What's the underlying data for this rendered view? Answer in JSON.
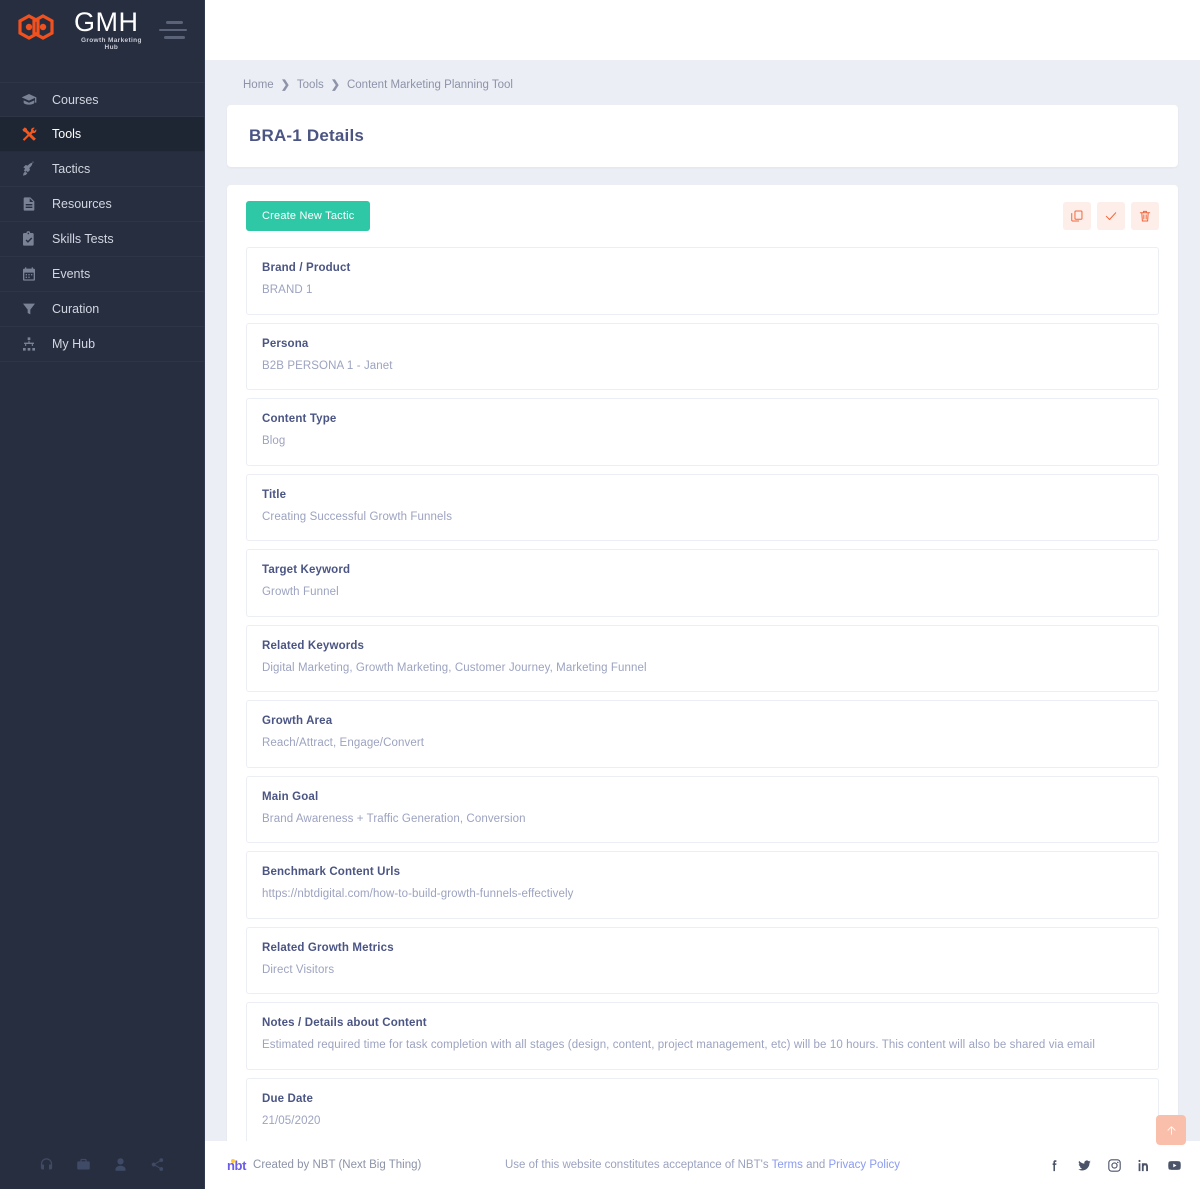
{
  "brand": {
    "logo_title": "GMH",
    "logo_subtitle": "Growth Marketing Hub",
    "accent_orange": "#f05a22"
  },
  "sidebar": {
    "items": [
      {
        "label": "Courses",
        "icon": "graduation-cap-icon",
        "active": false
      },
      {
        "label": "Tools",
        "icon": "tools-icon",
        "active": true
      },
      {
        "label": "Tactics",
        "icon": "rocket-icon",
        "active": false
      },
      {
        "label": "Resources",
        "icon": "document-icon",
        "active": false
      },
      {
        "label": "Skills Tests",
        "icon": "clipboard-check-icon",
        "active": false
      },
      {
        "label": "Events",
        "icon": "calendar-icon",
        "active": false
      },
      {
        "label": "Curation",
        "icon": "filter-icon",
        "active": false
      },
      {
        "label": "My Hub",
        "icon": "sitemap-icon",
        "active": false
      }
    ],
    "bottom_icons": [
      "headphones-icon",
      "briefcase-icon",
      "user-icon",
      "share-icon"
    ]
  },
  "breadcrumb": {
    "items": [
      "Home",
      "Tools",
      "Content Marketing Planning Tool"
    ],
    "separator": "❯"
  },
  "page": {
    "title": "BRA-1 Details"
  },
  "toolbar": {
    "create_label": "Create New Tactic",
    "create_color": "#2ec8a6",
    "icon_buttons": [
      {
        "name": "duplicate-button",
        "icon": "copy-icon"
      },
      {
        "name": "approve-button",
        "icon": "check-icon"
      },
      {
        "name": "delete-button",
        "icon": "trash-icon"
      }
    ],
    "icon_button_color": "#f2653a"
  },
  "fields": [
    {
      "label": "Brand / Product",
      "value": "BRAND 1"
    },
    {
      "label": "Persona",
      "value": "B2B PERSONA 1 - Janet"
    },
    {
      "label": "Content Type",
      "value": "Blog"
    },
    {
      "label": "Title",
      "value": "Creating Successful Growth Funnels"
    },
    {
      "label": "Target Keyword",
      "value": "Growth Funnel"
    },
    {
      "label": "Related Keywords",
      "value": "Digital Marketing, Growth Marketing, Customer Journey, Marketing Funnel"
    },
    {
      "label": "Growth Area",
      "value": "Reach/Attract, Engage/Convert"
    },
    {
      "label": "Main Goal",
      "value": "Brand Awareness + Traffic Generation, Conversion"
    },
    {
      "label": "Benchmark Content Urls",
      "value": "https://nbtdigital.com/how-to-build-growth-funnels-effectively"
    },
    {
      "label": "Related Growth Metrics",
      "value": "Direct Visitors"
    },
    {
      "label": "Notes / Details about Content",
      "value": "Estimated required time for task completion with all stages (design, content, project management, etc) will be 10 hours. This content will also be shared via email"
    },
    {
      "label": "Due Date",
      "value": "21/05/2020"
    }
  ],
  "footer": {
    "nbt_logo": "nbt",
    "credit": "Created by  NBT (Next Big Thing)",
    "legal_prefix": "Use of this website constitutes acceptance of NBT's ",
    "legal_terms": "Terms",
    "legal_and": " and ",
    "legal_privacy": "Privacy Policy",
    "social": [
      "facebook-icon",
      "twitter-icon",
      "instagram-icon",
      "linkedin-icon",
      "youtube-icon"
    ],
    "scroll_top_icon": "arrow-up-icon"
  }
}
